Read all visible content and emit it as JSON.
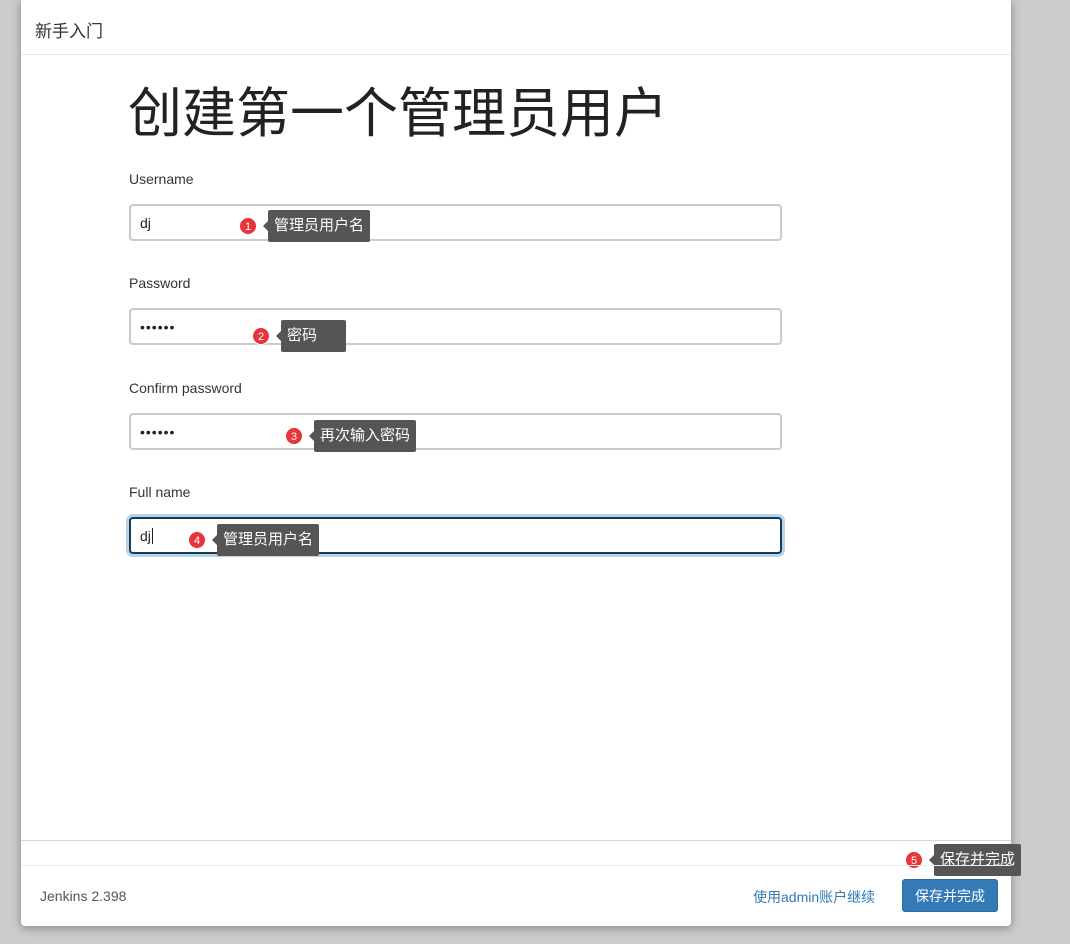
{
  "header": {
    "title": "新手入门"
  },
  "page": {
    "title": "创建第一个管理员用户"
  },
  "form": {
    "username": {
      "label": "Username",
      "value": "dj"
    },
    "password": {
      "label": "Password",
      "value": "••••••"
    },
    "confirm_password": {
      "label": "Confirm password",
      "value": "••••••"
    },
    "full_name": {
      "label": "Full name",
      "value": "dj"
    }
  },
  "annotations": [
    {
      "number": "1",
      "text": "管理员用户名"
    },
    {
      "number": "2",
      "text": "密码"
    },
    {
      "number": "3",
      "text": "再次输入密码"
    },
    {
      "number": "4",
      "text": "管理员用户名"
    },
    {
      "number": "5",
      "text": "保存并完成"
    }
  ],
  "footer": {
    "version": "Jenkins 2.398",
    "continue_link": "使用admin账户继续",
    "save_button": "保存并完成"
  },
  "colors": {
    "accent": "#337ab7",
    "marker": "#e8343a",
    "tooltip": "#555555"
  }
}
